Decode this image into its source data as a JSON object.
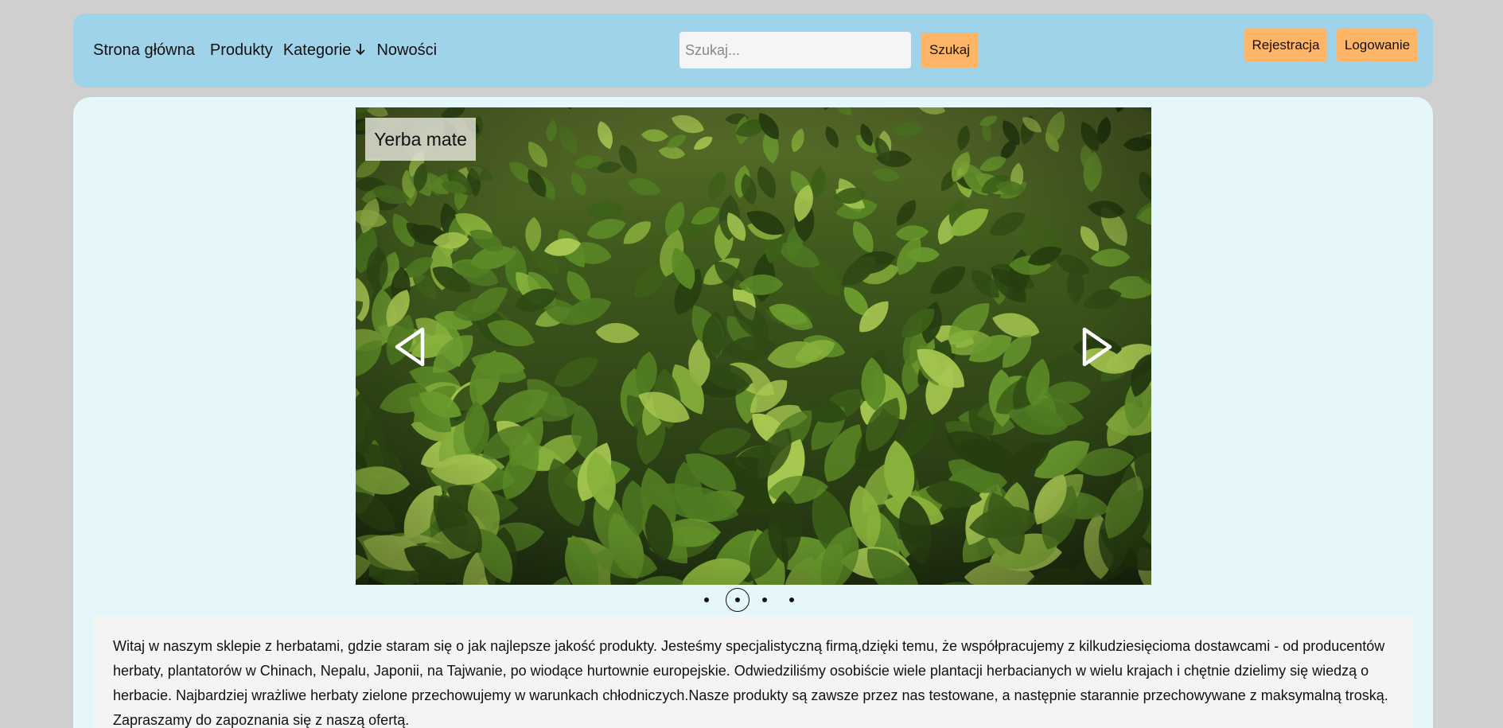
{
  "nav": {
    "items": [
      {
        "label": "Strona główna"
      },
      {
        "label": "Produkty"
      },
      {
        "label": "Kategorie"
      },
      {
        "label": "Nowości"
      }
    ]
  },
  "search": {
    "placeholder": "Szukaj...",
    "value": "",
    "button_label": "Szukaj"
  },
  "auth": {
    "register_label": "Rejestracja",
    "login_label": "Logowanie"
  },
  "slider": {
    "caption": "Yerba mate",
    "slide_count": 4,
    "active_index": 1
  },
  "welcome": {
    "text": "Witaj w naszym sklepie z herbatami, gdzie staram się o jak najlepsze jakość produkty. Jesteśmy specjalistyczną firmą,dzięki temu, że współpracujemy z kilkudziesięcioma dostawcami - od producentów herbaty, plantatorów w Chinach, Nepalu, Japonii, na Tajwanie, po wiodące hurtownie europejskie. Odwiedziliśmy osobiście wiele plantacji herbacianych w wielu krajach i chętnie dzielimy się wiedzą o herbacie. Najbardziej wrażliwe herbaty zielone przechowujemy w warunkach chłodniczych.Nasze produkty są zawsze przez nas testowane, a następnie starannie przechowywane z maksymalną troską. Zapraszamy do zapoznania się z naszą ofertą."
  },
  "colors": {
    "navbar_bg": "#9fd3ea",
    "button_bg": "#ffb567",
    "main_bg": "#e6f7fc",
    "page_bg": "#cfcfcf"
  }
}
